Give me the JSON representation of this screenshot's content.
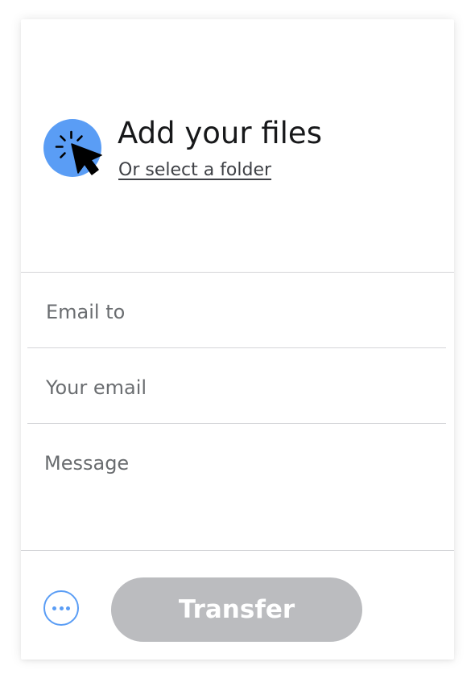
{
  "upload": {
    "title": "Add your files",
    "folder_link": "Or select a folder",
    "icon": "cursor-click-icon"
  },
  "form": {
    "email_to_placeholder": "Email to",
    "your_email_placeholder": "Your email",
    "message_placeholder": "Message"
  },
  "footer": {
    "more_icon": "more-options-icon",
    "transfer_label": "Transfer"
  },
  "colors": {
    "accent": "#5a9df5",
    "disabled_button": "#bbbcbf",
    "divider": "#d4d5d8"
  }
}
